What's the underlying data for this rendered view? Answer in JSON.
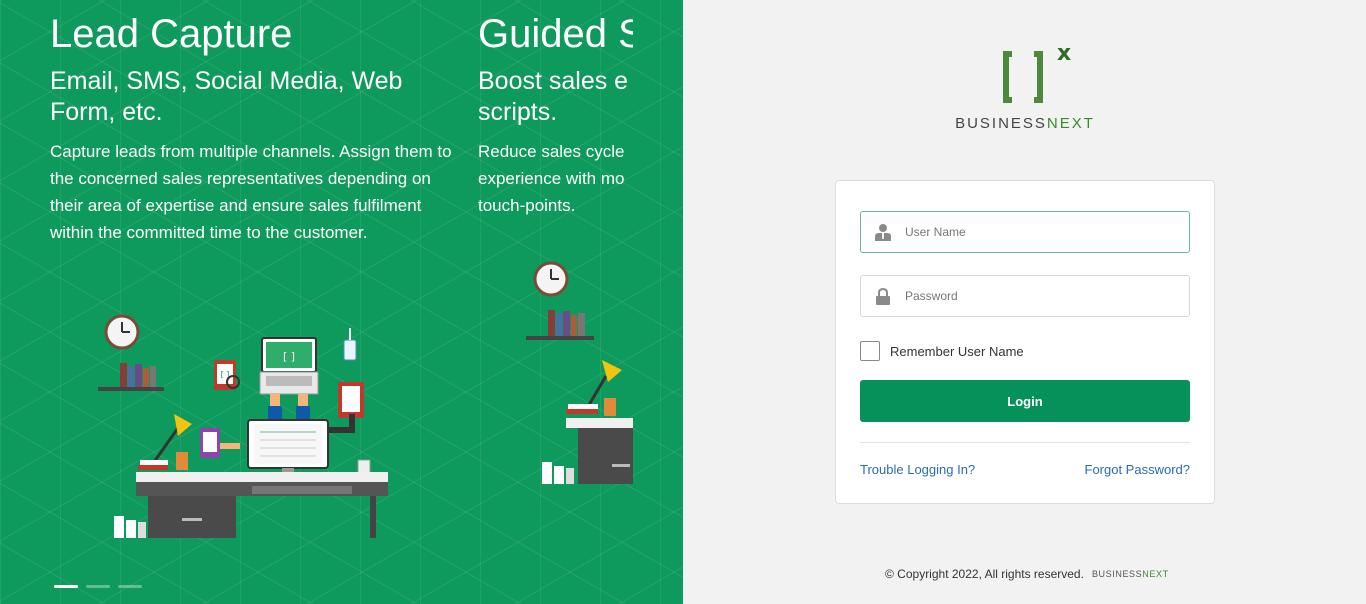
{
  "carousel": {
    "slides": [
      {
        "title": "Lead Capture",
        "subtitle": "Email, SMS, Social Media, Web Form, etc.",
        "body": "Capture leads from multiple channels. Assign them to the concerned sales representatives depending on their area of expertise and ensure sales fulfilment within the committed time to the customer."
      },
      {
        "title": "Guided S",
        "subtitle_line1": "Boost sales e",
        "subtitle_line2": "scripts.",
        "body_line1": "Reduce sales cycle",
        "body_line2": "experience with mo",
        "body_line3": "touch-points."
      }
    ],
    "active_dot": 1,
    "dot_count": 3
  },
  "brand": {
    "mark_bracket": "[ ]",
    "mark_sup": "x",
    "word_business": "BUSINESS",
    "word_next": "NEXT",
    "colors": {
      "green": "#07915a",
      "logo_green": "#3a8a2f",
      "link": "#2a6bb5"
    }
  },
  "login": {
    "username_placeholder": "User Name",
    "password_placeholder": "Password",
    "remember_label": "Remember User Name",
    "login_label": "Login",
    "trouble_link": "Trouble Logging In?",
    "forgot_link": "Forgot Password?"
  },
  "footer": {
    "copyright": "© Copyright 2022, All rights reserved."
  }
}
